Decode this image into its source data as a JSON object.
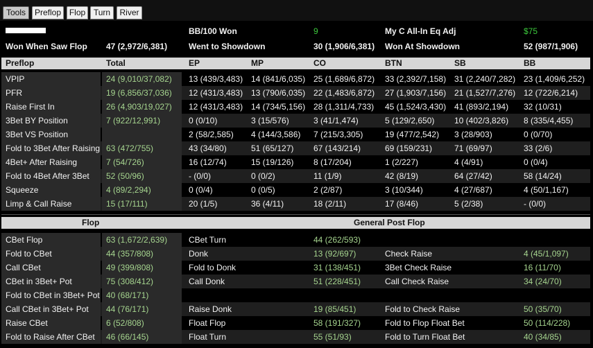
{
  "tabs": [
    "Tools",
    "Preflop",
    "Flop",
    "Turn",
    "River"
  ],
  "summary": {
    "bb100_label": "BB/100 Won",
    "bb100_value": "9",
    "allin_label": "My C All-In Eq Adj",
    "allin_value": "$75",
    "wwsf_label": "Won When Saw Flop",
    "wwsf_value": "47 (2,972/6,381)",
    "wtsd_label": "Went to Showdown",
    "wtsd_value": "30 (1,906/6,381)",
    "wasd_label": "Won At Showdown",
    "wasd_value": "52 (987/1,906)"
  },
  "preflop": {
    "headers": [
      "Preflop",
      "Total",
      "EP",
      "MP",
      "CO",
      "BTN",
      "SB",
      "BB"
    ],
    "rows": [
      [
        "VPIP",
        "24 (9,010/37,082)",
        "13 (439/3,483)",
        "14 (841/6,035)",
        "25 (1,689/6,872)",
        "33 (2,392/7,158)",
        "31 (2,240/7,282)",
        "23 (1,409/6,252)"
      ],
      [
        "PFR",
        "19 (6,856/37,036)",
        "12 (431/3,483)",
        "13 (790/6,035)",
        "22 (1,483/6,872)",
        "27 (1,903/7,156)",
        "21 (1,527/7,276)",
        "12 (722/6,214)"
      ],
      [
        "Raise First In",
        "26 (4,903/19,027)",
        "12 (431/3,483)",
        "14 (734/5,156)",
        "28 (1,311/4,733)",
        "45 (1,524/3,430)",
        "41 (893/2,194)",
        "32 (10/31)"
      ],
      [
        "3Bet BY Position",
        "7 (922/12,991)",
        "0 (0/10)",
        "3 (15/576)",
        "3 (41/1,474)",
        "5 (129/2,650)",
        "10 (402/3,826)",
        "8 (335/4,455)"
      ],
      [
        "3Bet VS Position",
        "",
        "2 (58/2,585)",
        "4 (144/3,586)",
        "7 (215/3,305)",
        "19 (477/2,542)",
        "3 (28/903)",
        "0 (0/70)"
      ],
      [
        "Fold to 3Bet After Raising",
        "63 (472/755)",
        "43 (34/80)",
        "51 (65/127)",
        "67 (143/214)",
        "69 (159/231)",
        "71 (69/97)",
        "33 (2/6)"
      ],
      [
        "4Bet+ After Raising",
        "7 (54/726)",
        "16 (12/74)",
        "15 (19/126)",
        "8 (17/204)",
        "1 (2/227)",
        "4 (4/91)",
        "0 (0/4)"
      ],
      [
        "Fold to 4Bet After 3Bet",
        "52 (50/96)",
        "- (0/0)",
        "0 (0/2)",
        "11 (1/9)",
        "42 (8/19)",
        "64 (27/42)",
        "58 (14/24)"
      ],
      [
        "Squeeze",
        "4 (89/2,294)",
        "0 (0/4)",
        "0 (0/5)",
        "2 (2/87)",
        "3 (10/344)",
        "4 (27/687)",
        "4 (50/1,167)"
      ],
      [
        "Limp & Call Raise",
        "15 (17/111)",
        "20 (1/5)",
        "36 (4/11)",
        "18 (2/11)",
        "17 (8/46)",
        "5 (2/38)",
        "- (0/0)"
      ]
    ]
  },
  "postflop": {
    "flop_header": "Flop",
    "general_header": "General Post Flop",
    "rows": [
      [
        "CBet Flop",
        "63 (1,672/2,639)",
        "CBet Turn",
        "44 (262/593)",
        "",
        ""
      ],
      [
        "Fold to CBet",
        "44 (357/808)",
        "Donk",
        "13 (92/697)",
        "Check Raise",
        "4 (45/1,097)"
      ],
      [
        "Call CBet",
        "49 (399/808)",
        "Fold to Donk",
        "31 (138/451)",
        "3Bet Check Raise",
        "16 (11/70)"
      ],
      [
        "CBet in 3Bet+ Pot",
        "75 (308/412)",
        "Call Donk",
        "51 (228/451)",
        "Call Check Raise",
        "34 (24/70)"
      ],
      [
        "Fold to CBet in 3Bet+ Pot",
        "40 (68/171)",
        "",
        "",
        "",
        ""
      ],
      [
        "Call CBet in 3Bet+ Pot",
        "44 (76/171)",
        "Raise Donk",
        "19 (85/451)",
        "Fold to Check Raise",
        "50 (35/70)"
      ],
      [
        "Raise CBet",
        "6 (52/808)",
        "Float Flop",
        "58 (191/327)",
        "Fold to Flop Float Bet",
        "50 (114/228)"
      ],
      [
        "Fold to Raise After CBet",
        "46 (66/145)",
        "Float Turn",
        "55 (51/93)",
        "Fold to Turn Float Bet",
        "40 (34/85)"
      ]
    ]
  }
}
